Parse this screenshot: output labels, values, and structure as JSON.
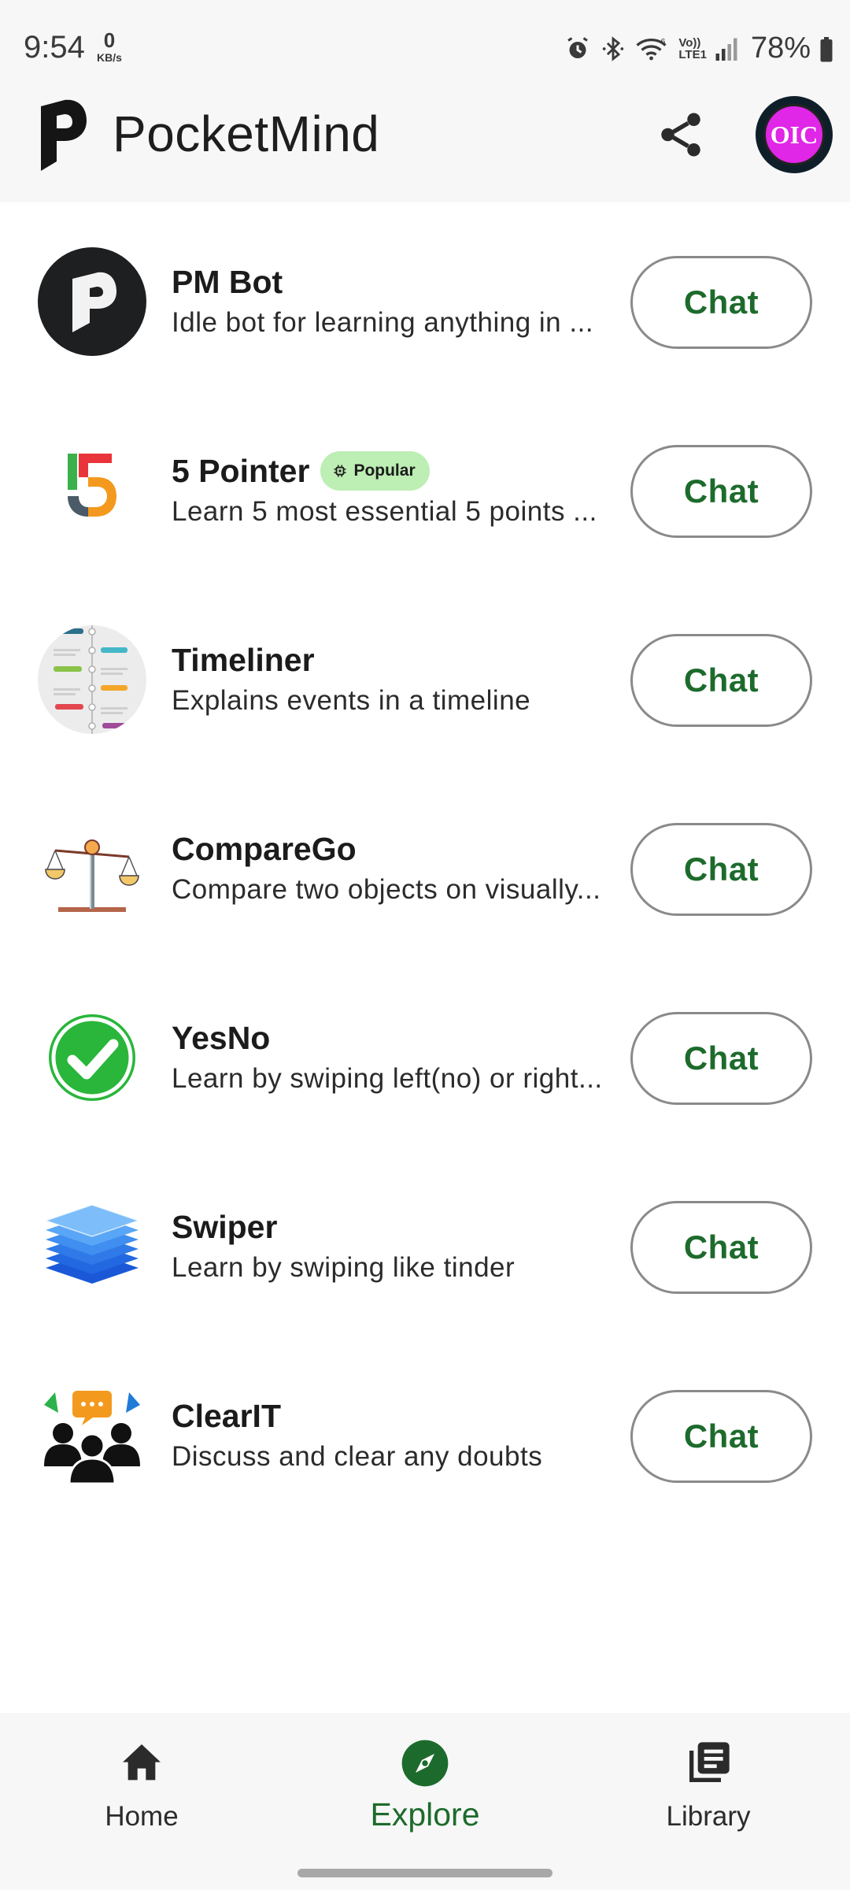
{
  "status_bar": {
    "time": "9:54",
    "net_speed_value": "0",
    "net_speed_unit": "KB/s",
    "battery": "78%",
    "icons": [
      "alarm-icon",
      "bluetooth-icon",
      "wifi-icon",
      "volte-icon",
      "signal-icon",
      "battery-icon"
    ],
    "volte_top": "Vo))",
    "volte_bottom": "LTE1"
  },
  "app_bar": {
    "title": "PocketMind",
    "avatar_text": "OIC"
  },
  "bots": [
    {
      "name": "PM Bot",
      "description": "Idle bot for learning anything in ...",
      "icon": "pm-bot-logo-icon",
      "action": "Chat"
    },
    {
      "name": "5 Pointer",
      "badge": "Popular",
      "description": "Learn 5 most essential 5 points ...",
      "icon": "five-pointer-icon",
      "action": "Chat"
    },
    {
      "name": "Timeliner",
      "description": "Explains events in a timeline",
      "icon": "timeline-icon",
      "action": "Chat"
    },
    {
      "name": "CompareGo",
      "description": "Compare two objects on visually...",
      "icon": "balance-scale-icon",
      "action": "Chat"
    },
    {
      "name": "YesNo",
      "description": "Learn by swiping left(no) or right...",
      "icon": "checkmark-icon",
      "action": "Chat"
    },
    {
      "name": "Swiper",
      "description": "Learn by swiping like tinder",
      "icon": "stacked-layers-icon",
      "action": "Chat"
    },
    {
      "name": "ClearIT",
      "description": "Discuss and clear any doubts",
      "icon": "group-discussion-icon",
      "action": "Chat"
    }
  ],
  "bottom_nav": {
    "items": [
      {
        "label": "Home",
        "icon": "home-icon",
        "active": false
      },
      {
        "label": "Explore",
        "icon": "compass-icon",
        "active": true
      },
      {
        "label": "Library",
        "icon": "library-icon",
        "active": false
      }
    ]
  },
  "colors": {
    "accent_green": "#1d6b2c",
    "badge_bg": "#bdeeb4",
    "bar_bg": "#f7f7f7",
    "avatar_magenta": "#e026e6"
  }
}
